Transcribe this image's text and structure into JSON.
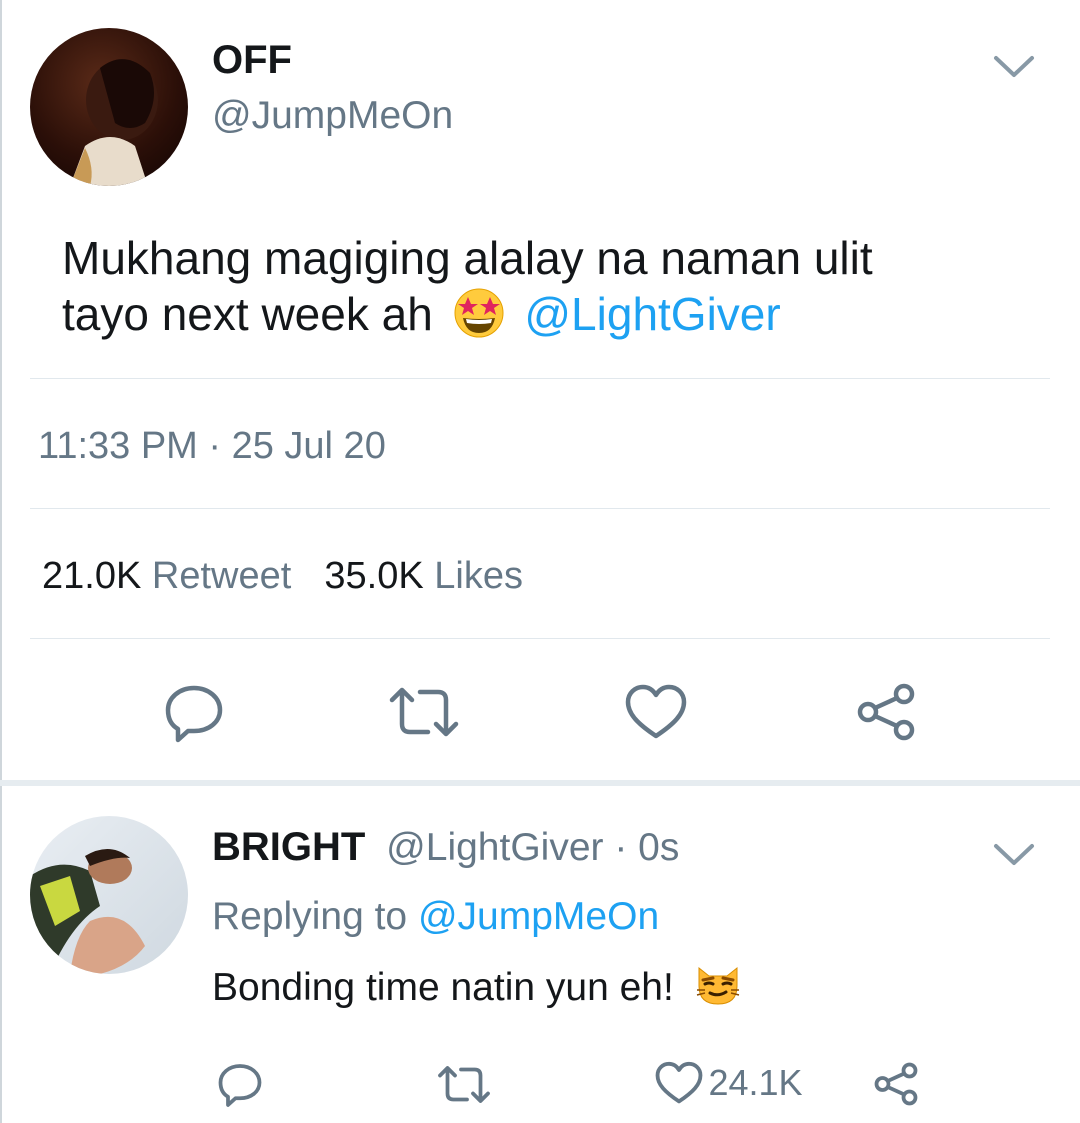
{
  "tweet": {
    "author_name": "OFF",
    "author_handle": "@JumpMeOn",
    "text_line1": "Mukhang magiging alalay na naman ulit",
    "text_line2": "tayo next week ah",
    "mention": "@LightGiver",
    "emoji_icon": "star-struck-emoji",
    "timestamp": "11:33 PM · 25 Jul 20",
    "retweet_count": "21.0K",
    "retweet_label": "Retweet",
    "likes_count": "35.0K",
    "likes_label": "Likes",
    "actions": [
      "reply-icon",
      "retweet-icon",
      "like-icon",
      "share-icon"
    ]
  },
  "reply": {
    "author_name": "BRIGHT",
    "author_handle": "@LightGiver",
    "time": "· 0s",
    "replying_prefix": "Replying to",
    "replying_handle": "@JumpMeOn",
    "text": "Bonding time natin yun eh!",
    "emoji_icon": "smirking-cat-emoji",
    "like_count": "24.1K",
    "actions": [
      "reply-icon",
      "retweet-icon",
      "like-icon",
      "share-icon"
    ]
  },
  "colors": {
    "link": "#1da1f2",
    "secondary_text": "#657786",
    "icon": "#657786",
    "divider": "#e1e8ed"
  }
}
